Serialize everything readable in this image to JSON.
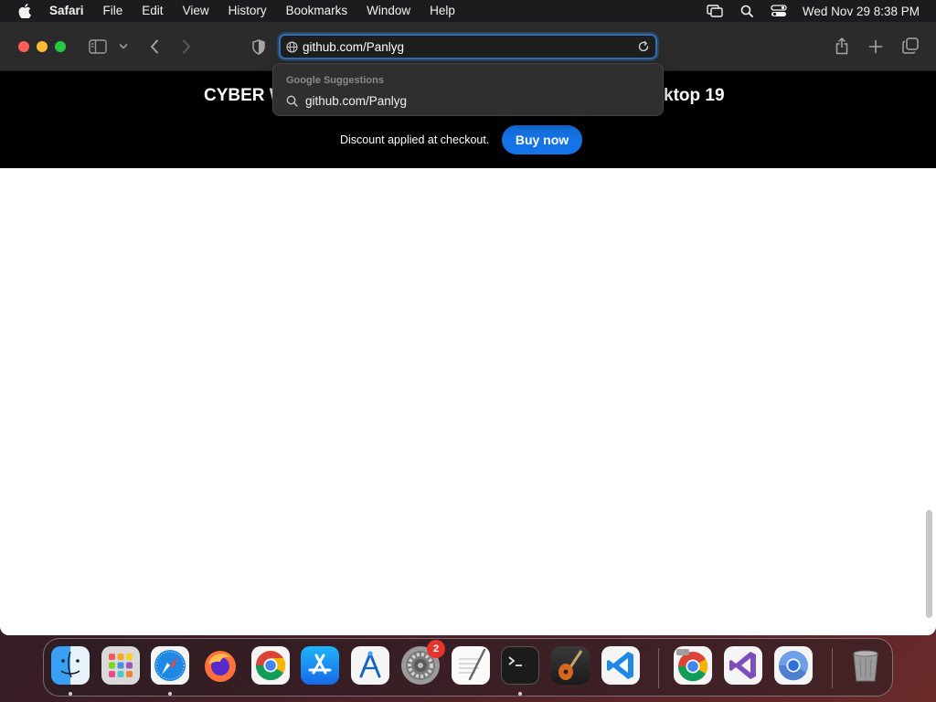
{
  "menubar": {
    "apple_icon": "apple-logo",
    "app_name": "Safari",
    "items": [
      "File",
      "Edit",
      "View",
      "History",
      "Bookmarks",
      "Window",
      "Help"
    ],
    "right_icons": [
      "screen-mirroring-icon",
      "search-icon",
      "control-center-icon"
    ],
    "clock": "Wed Nov 29  8:38 PM"
  },
  "toolbar": {
    "address_value": "github.com/Panlyg",
    "icons": [
      "sidebar-icon",
      "chevron-down-icon",
      "back-icon",
      "forward-icon",
      "privacy-shield-icon",
      "share-icon",
      "new-tab-icon",
      "tab-overview-icon"
    ]
  },
  "suggestions": {
    "header": "Google Suggestions",
    "items": [
      "github.com/Panlyg"
    ]
  },
  "banner": {
    "headline_left": "CYBER W",
    "headline_right": "ktop 19",
    "discount_text": "Discount applied at checkout.",
    "buy_label": "Buy now",
    "buy_color": "#1473e6"
  },
  "dock": {
    "apps": [
      "Finder",
      "Launchpad",
      "Safari",
      "Firefox",
      "Google Chrome",
      "App Store",
      "Instruments",
      "System Settings",
      "TextEdit",
      "Terminal",
      "GarageBand",
      "Visual Studio Code",
      "Chrome Dev",
      "Visual Studio",
      "Chromium",
      "Trash"
    ],
    "settings_badge": "2"
  }
}
